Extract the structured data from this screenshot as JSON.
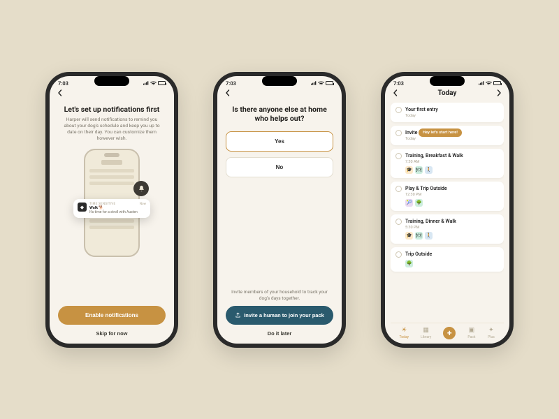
{
  "status": {
    "time": "7:03"
  },
  "screen1": {
    "title": "Let's set up notifications first",
    "body": "Harper will send notifications to remind you about your dog's schedule and keep you up to date on their day. You can customize them however wish.",
    "notif": {
      "tag": "TIME SENSITIVE",
      "title": "Walk 🐕",
      "body": "It's time for a stroll with Austen",
      "when": "Now"
    },
    "primary": "Enable notifications",
    "skip": "Skip for now"
  },
  "screen2": {
    "title": "Is there anyone else at home who helps out?",
    "yes": "Yes",
    "no": "No",
    "helper": "Invite members of your household to track your dog's days together.",
    "invite": "Invite a human to join your pack",
    "later": "Do it later"
  },
  "screen3": {
    "title": "Today",
    "tooltip": "Hey let's start here!",
    "items": [
      {
        "title": "Your first entry",
        "time": "Today"
      },
      {
        "title": "Invite",
        "time": "Today"
      },
      {
        "title": "Training, Breakfast & Walk",
        "time": "7:30 AM"
      },
      {
        "title": "Play & Trip Outside",
        "time": "12:30 PM"
      },
      {
        "title": "Training, Dinner & Walk",
        "time": "5:30 PM"
      },
      {
        "title": "Trip Outside",
        "time": ""
      }
    ],
    "tabs": {
      "today": "Today",
      "library": "Library",
      "pack": "Pack",
      "plus": "Plus"
    }
  }
}
